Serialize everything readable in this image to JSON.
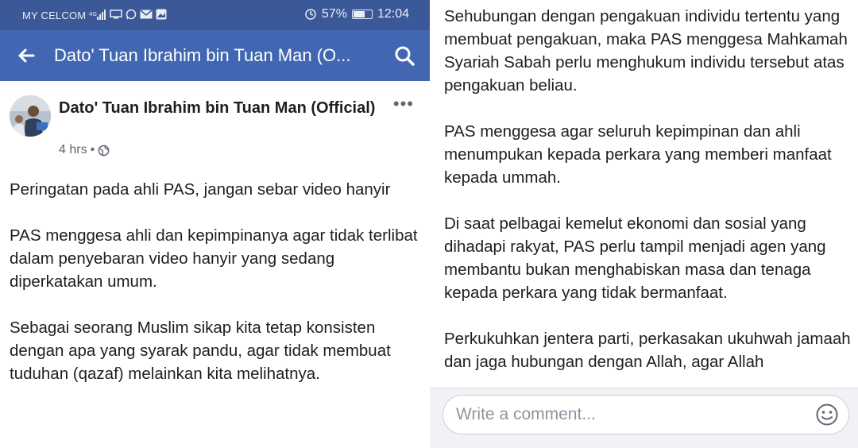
{
  "status_bar": {
    "carrier": "MY CELCOM",
    "battery_percent": "57%",
    "battery_level": 0.57,
    "time": "12:04"
  },
  "app_bar": {
    "title": "Dato' Tuan Ibrahim bin Tuan Man (O...",
    "back_icon": "arrow-left-icon",
    "search_icon": "search-icon"
  },
  "post": {
    "author": "Dato' Tuan Ibrahim bin Tuan Man (Official)",
    "time": "4 hrs",
    "separator": "•",
    "privacy_icon": "globe-icon",
    "more_label": "•••",
    "paragraphs": [
      "Peringatan pada ahli PAS, jangan sebar video hanyir",
      "PAS menggesa ahli dan kepimpinanya agar tidak terlibat dalam penyebaran video hanyir yang sedang diperkatakan umum.",
      "Sebagai seorang Muslim sikap kita tetap konsisten dengan apa yang syarak pandu, agar tidak membuat tuduhan (qazaf) melainkan kita melihatnya."
    ]
  },
  "continuation": {
    "paragraphs": [
      "Sehubungan dengan pengakuan individu tertentu yang membuat pengakuan, maka PAS menggesa Mahkamah Syariah Sabah perlu menghukum individu tersebut atas pengakuan beliau.",
      "PAS menggesa agar seluruh kepimpinan dan ahli menumpukan kepada perkara yang memberi manfaat kepada ummah.",
      "Di saat pelbagai kemelut ekonomi dan sosial yang dihadapi rakyat, PAS perlu tampil menjadi agen yang membantu bukan menghabiskan masa dan tenaga kepada perkara yang tidak bermanfaat.",
      "Perkukuhkan jentera parti, perkasakan ukuhwah jamaah dan jaga hubungan dengan Allah, agar Allah"
    ]
  },
  "comment": {
    "placeholder": "Write a comment...",
    "emoji_icon": "smiley-icon"
  },
  "colors": {
    "status_bar": "#3b5998",
    "app_bar": "#4267b2",
    "text": "#1c1e21",
    "meta": "#606770",
    "comment_bg": "#f0f2f5"
  }
}
